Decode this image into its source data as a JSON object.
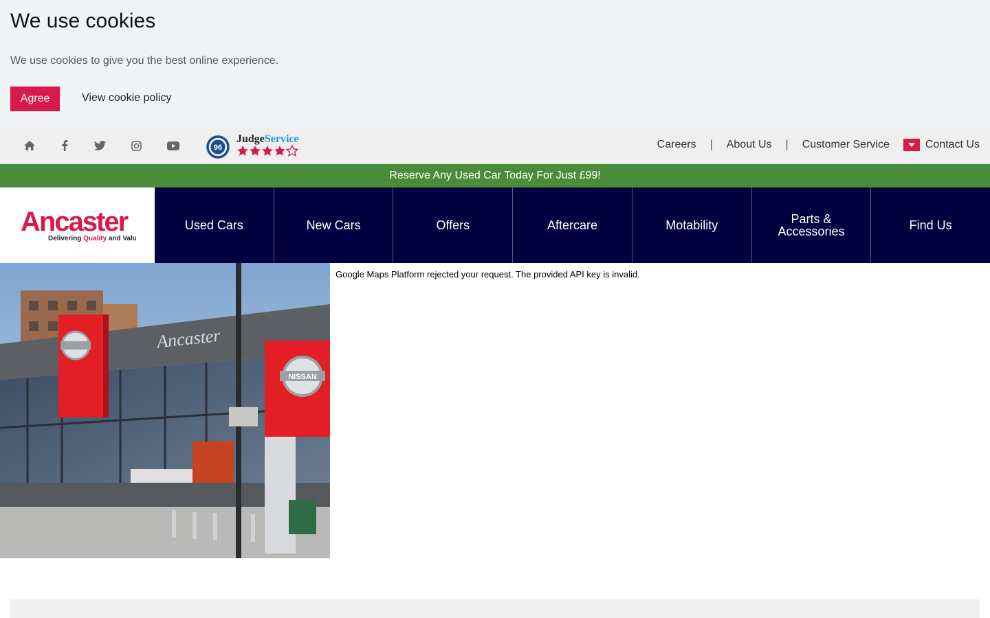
{
  "cookie": {
    "title": "We use cookies",
    "message": "We use cookies to give you the best online experience.",
    "agree_label": "Agree",
    "policy_label": "View cookie policy"
  },
  "topbar": {
    "social_icons": [
      "home-icon",
      "facebook-icon",
      "twitter-icon",
      "instagram-icon",
      "youtube-icon"
    ],
    "judge": {
      "score": "96",
      "brand_part1": "Judge",
      "brand_part2": "Service"
    },
    "links": [
      "Careers",
      "About Us",
      "Customer Service"
    ],
    "contact_label": "Contact Us"
  },
  "promo": {
    "text": "Reserve Any Used Car Today For Just £99!"
  },
  "logo": {
    "name": "Ancaster",
    "tag_part1": "Delivering ",
    "tag_part2": "Quality",
    "tag_part3": " and Value"
  },
  "nav": {
    "items": [
      "Used Cars",
      "New Cars",
      "Offers",
      "Aftercare",
      "Motability",
      "Parts & Accessories",
      "Find Us"
    ]
  },
  "hero": {
    "building_sign": "Ancaster",
    "brand_sign": "NISSAN"
  },
  "map": {
    "error": "Google Maps Platform rejected your request. The provided API key is invalid."
  },
  "colors": {
    "accent": "#d8194b",
    "nav_bg": "#03003f",
    "promo_bg": "#4a8c3a",
    "cookie_bg": "#f1f4f7"
  }
}
